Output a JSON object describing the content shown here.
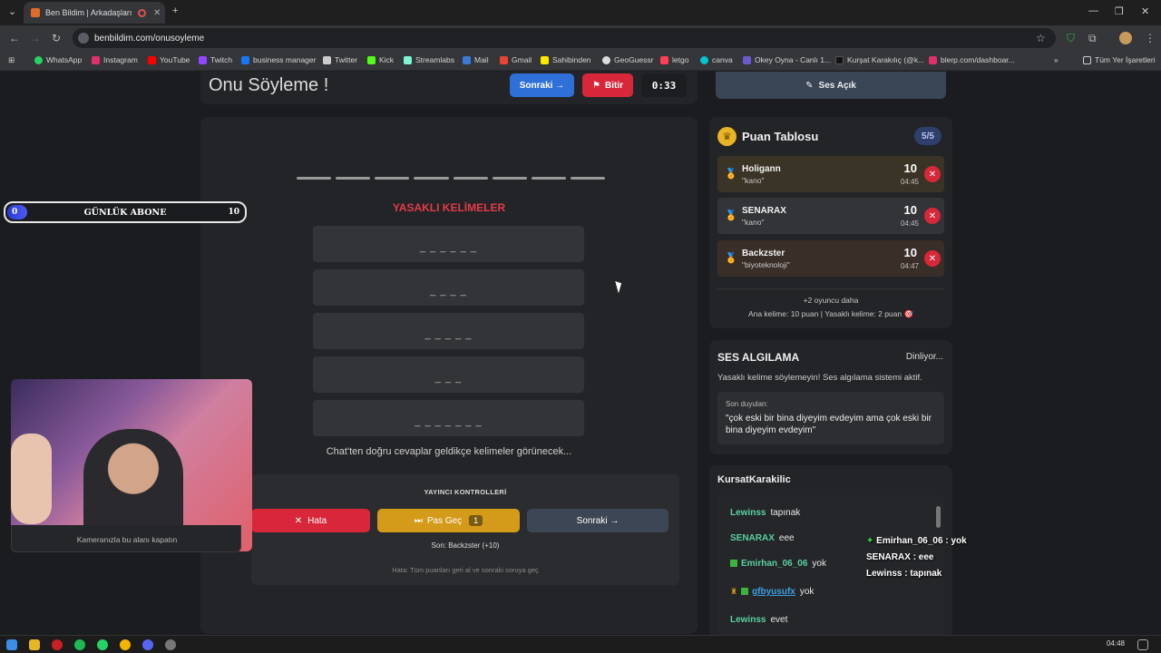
{
  "browser": {
    "tab_title": "Ben Bildim | Arkadaşlarınla",
    "url": "benbildim.com/onusoyleme",
    "bookmarks": [
      {
        "label": "WhatsApp",
        "color": "#25d366"
      },
      {
        "label": "Instagram",
        "color": "#e1306c"
      },
      {
        "label": "YouTube",
        "color": "#ff0000"
      },
      {
        "label": "Twitch",
        "color": "#9146ff"
      },
      {
        "label": "business manager",
        "color": "#1877f2"
      },
      {
        "label": "Twitter",
        "color": "#cccccc"
      },
      {
        "label": "Kick",
        "color": "#53fc18"
      },
      {
        "label": "Streamlabs",
        "color": "#80f5d2"
      },
      {
        "label": "Mail",
        "color": "#3a7bd5"
      },
      {
        "label": "Gmail",
        "color": "#ea4335"
      },
      {
        "label": "Sahibinden",
        "color": "#ffe800"
      },
      {
        "label": "GeoGuessr",
        "color": "#dddddd"
      },
      {
        "label": "letgo",
        "color": "#ff3f55"
      },
      {
        "label": "canva",
        "color": "#00c4cc"
      },
      {
        "label": "Okey Oyna - Canlı 1...",
        "color": "#6a5acd"
      },
      {
        "label": "Kurşat Karakılıç (@k...",
        "color": "#111111"
      },
      {
        "label": "blerp.com/dashboar...",
        "color": "#e0306a"
      }
    ],
    "all_bookmarks": "Tüm Yer İşaretleri"
  },
  "header": {
    "title": "Onu Söyleme !",
    "next_label": "Sonraki →",
    "finish_label": "Bitir",
    "timer": "0:33",
    "voice_toggle": "Ses Açık"
  },
  "game": {
    "forbidden_title": "YASAKLI KELİMELER",
    "forbidden_words": [
      "_ _ _ _ _ _",
      "_ _ _ _",
      "_ _ _ _ _",
      "_ _ _",
      "_ _ _ _ _ _ _"
    ],
    "chat_hint": "Chat'ten doğru cevaplar geldikçe kelimeler görünecek...",
    "controls": {
      "title": "YAYINCI KONTROLLERİ",
      "error_label": "Hata",
      "pass_label": "Pas Geç",
      "pass_count": "1",
      "next_label": "Sonraki →",
      "last_info": "Son: Backzster (+10)",
      "error_hint": "Hata: Tüm puanları geri al ve sonraki soruya geç"
    }
  },
  "scoreboard": {
    "title": "Puan Tablosu",
    "count": "5/5",
    "players": [
      {
        "name": "Holigann",
        "word": "\"kano\"",
        "points": "10",
        "time": "04:45",
        "bg": "#3a3426",
        "medal": "#e8b524"
      },
      {
        "name": "SENARAX",
        "word": "\"kano\"",
        "points": "10",
        "time": "04:45",
        "bg": "#323438",
        "medal": "#b8c0cc"
      },
      {
        "name": "Backzster",
        "word": "\"biyoteknoloji\"",
        "points": "10",
        "time": "04:47",
        "bg": "#3a2e28",
        "medal": "#c87a3a"
      }
    ],
    "more": "+2 oyuncu daha",
    "scoring": "Ana kelime: 10 puan | Yasaklı kelime: 2 puan 🎯"
  },
  "voice": {
    "title": "SES ALGILAMA",
    "status": "Dinliyor...",
    "desc": "Yasaklı kelime söylemeyin! Ses algılama sistemi aktif.",
    "heard_label": "Son duyulan:",
    "heard_text": "\"çok eski bir bina diyeyim evdeyim ama çok eski bir bina diyeyim evdeyim\""
  },
  "chat": {
    "title": "KursatKarakilic",
    "messages": [
      {
        "user": "Lewinss",
        "text": "tapınak",
        "color": "#5ad0a0",
        "badge": false
      },
      {
        "user": "SENARAX",
        "text": "eee",
        "color": "#5ad0a0",
        "badge": false
      },
      {
        "user": "Emirhan_06_06",
        "text": "yok",
        "color": "#5ad0a0",
        "badge": true
      },
      {
        "user": "gfbyusufx",
        "text": "yok",
        "color": "#3aa0e0",
        "badge": true
      },
      {
        "user": "Lewinss",
        "text": "evet",
        "color": "#5ad0a0",
        "badge": false
      }
    ]
  },
  "overlay": {
    "min": "0",
    "label": "GÜNLÜK ABONE",
    "max": "10",
    "progress": 0
  },
  "webcam": {
    "caption": "Kameranızla bu alanı kapatın"
  },
  "stream_chat": [
    {
      "user": "Emirhan_06_06",
      "text": ": yok"
    },
    {
      "user": "SENARAX",
      "text": ": eee"
    },
    {
      "user": "Lewinss",
      "text": ": tapınak"
    }
  ],
  "taskbar": {
    "time": "04:48"
  }
}
